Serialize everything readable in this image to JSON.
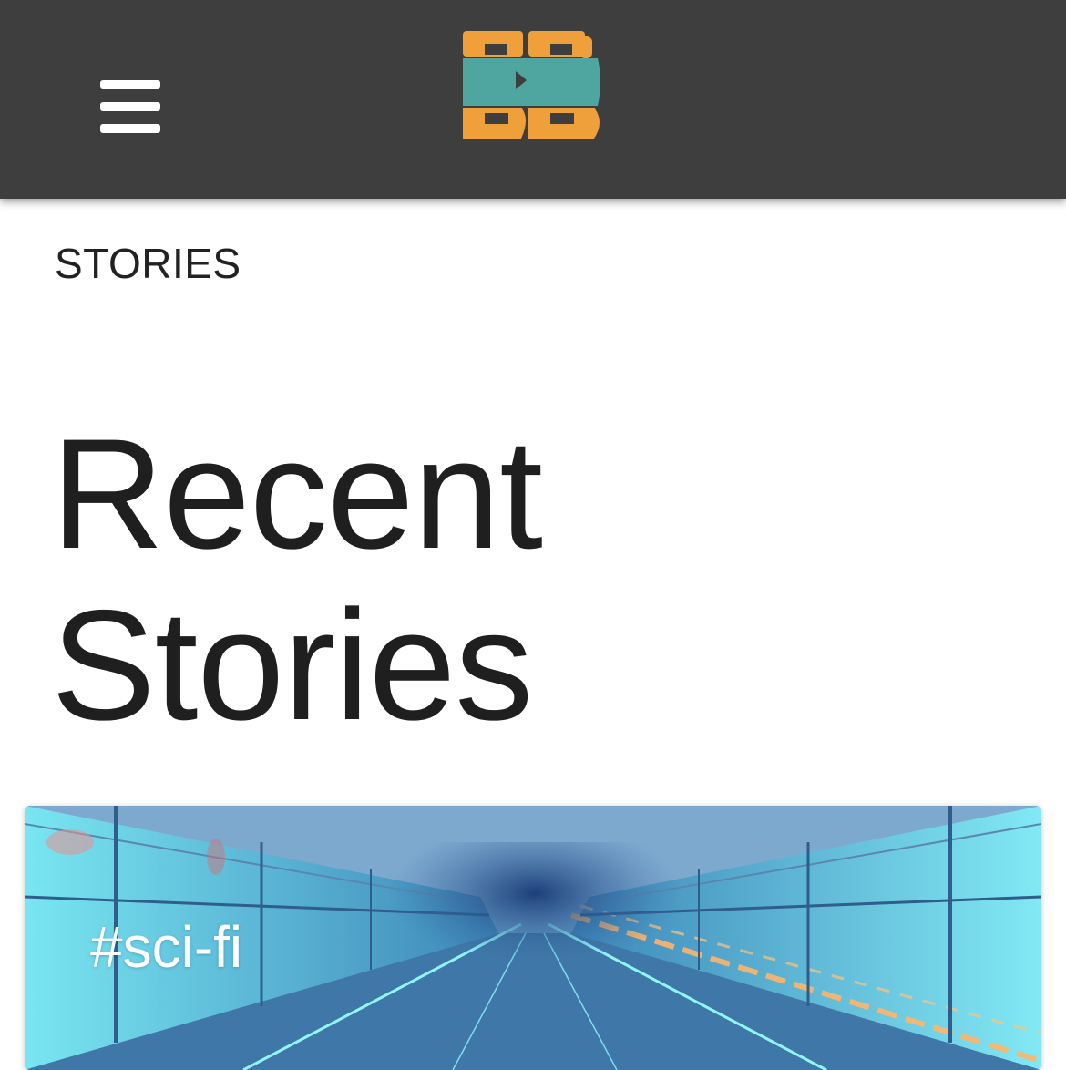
{
  "header": {
    "menu_icon": "hamburger-menu-icon",
    "logo_text": "BB",
    "logo_colors": {
      "orange": "#f0a03a",
      "teal": "#4fa6a0"
    },
    "background": "#3e3e3e"
  },
  "main": {
    "section_label": "STORIES",
    "title_line1": "Recent",
    "title_line2": "Stories"
  },
  "story_card": {
    "tag": "#sci-fi",
    "image": "sci-fi-tunnel-image"
  }
}
